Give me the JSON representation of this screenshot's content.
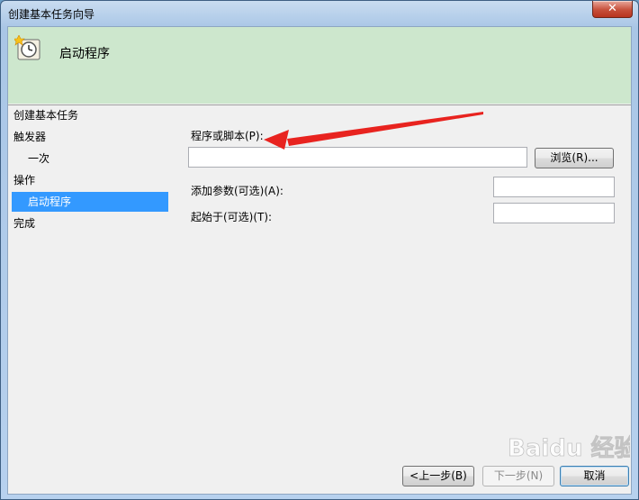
{
  "window": {
    "title": "创建基本任务向导",
    "close_symbol": "✕"
  },
  "header": {
    "title": "启动程序",
    "icon": "clock-task-icon"
  },
  "nav": {
    "items": [
      {
        "label": "创建基本任务"
      },
      {
        "label": "触发器"
      },
      {
        "label": "一次"
      },
      {
        "label": "操作"
      },
      {
        "label": "启动程序"
      },
      {
        "label": "完成"
      }
    ]
  },
  "form": {
    "program_label": "程序或脚本(P):",
    "program_value": "",
    "browse_label": "浏览(R)...",
    "args_label": "添加参数(可选)(A):",
    "args_value": "",
    "start_in_label": "起始于(可选)(T):",
    "start_in_value": ""
  },
  "footer": {
    "back_label": "<上一步(B)",
    "next_label": "下一步(N)",
    "cancel_label": "取消"
  },
  "annotation": {
    "arrow_color": "#e8231f"
  },
  "watermark": {
    "text": "Baidu 经验"
  }
}
